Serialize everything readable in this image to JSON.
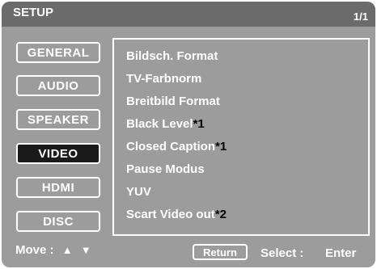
{
  "header": {
    "title": "SETUP",
    "page": "1/1"
  },
  "tabs": [
    {
      "label": "GENERAL"
    },
    {
      "label": "AUDIO"
    },
    {
      "label": "SPEAKER"
    },
    {
      "label": "VIDEO"
    },
    {
      "label": "HDMI"
    },
    {
      "label": "DISC"
    }
  ],
  "active_tab": "VIDEO",
  "menu": {
    "items": [
      {
        "label": "Bildsch. Format",
        "note": ""
      },
      {
        "label": "TV-Farbnorm",
        "note": ""
      },
      {
        "label": "Breitbild Format",
        "note": ""
      },
      {
        "label": "Black Level",
        "note": "*1"
      },
      {
        "label": "Closed Caption",
        "note": "*1"
      },
      {
        "label": "Pause Modus",
        "note": ""
      },
      {
        "label": "YUV",
        "note": ""
      },
      {
        "label": "Scart Video out",
        "note": "*2"
      }
    ]
  },
  "footer": {
    "move_label": "Move :",
    "up_arrow": "▲",
    "down_arrow": "▼",
    "return_label": "Return",
    "select_label": "Select :",
    "enter_label": "Enter"
  },
  "colors": {
    "background": "#9c9c9c",
    "titlebar": "#6b6b6b",
    "active_tab": "#1a1a1a",
    "text": "#ffffff",
    "note": "#000000"
  }
}
